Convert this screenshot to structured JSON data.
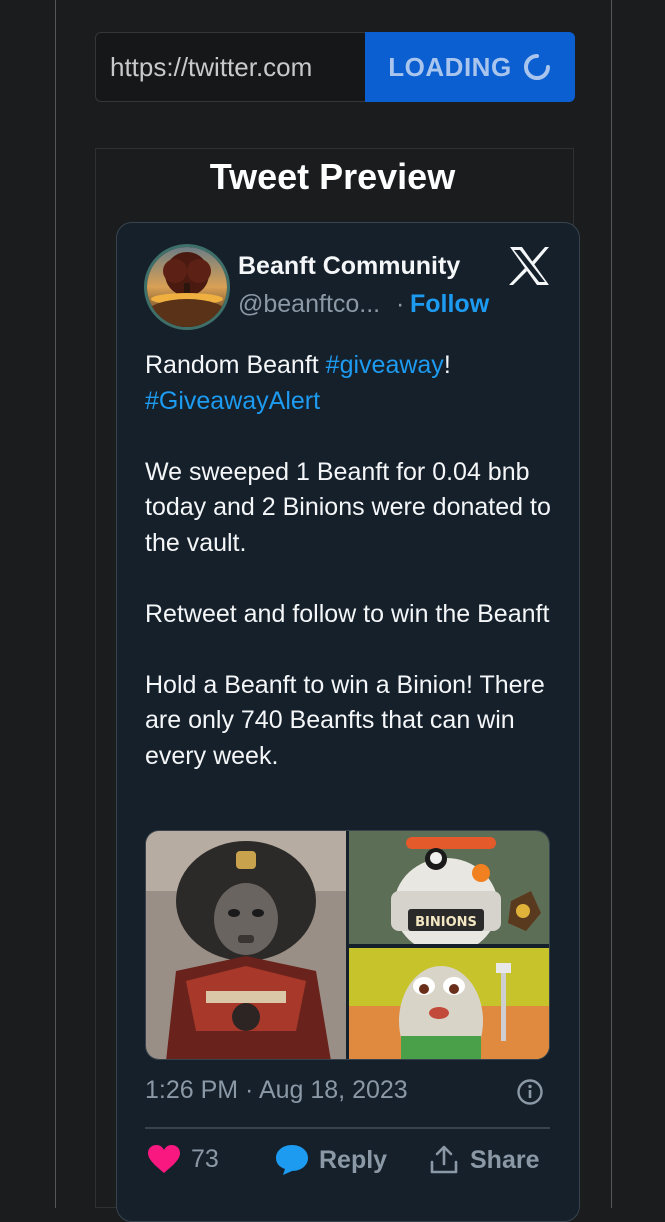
{
  "url_bar": {
    "url_value": "https://twitter.com",
    "load_button_label": "LOADING"
  },
  "preview": {
    "title": "Tweet Preview"
  },
  "tweet": {
    "author_name": "Beanft Community",
    "handle": "@beanftco...",
    "separator": "·",
    "follow_label": "Follow",
    "text": {
      "l1_prefix": "Random Beanft ",
      "l1_tag": "#giveaway",
      "l1_suffix": "!",
      "l2_tag": "#GiveawayAlert",
      "p2": "We sweeped 1 Beanft for 0.04 bnb today and 2 Binions were donated to the vault.",
      "p3": "Retweet and follow to win the Beanft",
      "p4": "Hold a Beanft to win a Binion! There are only 740 Beanfts that can win every week."
    },
    "media": {
      "binions_label": "BINIONS"
    },
    "timestamp": "1:26 PM · Aug 18, 2023",
    "like_count": "73",
    "reply_label": "Reply",
    "share_label": "Share"
  },
  "colors": {
    "accent_blue": "#1d9bf0",
    "button_blue": "#0b5fd1",
    "like_pink": "#f91880",
    "card_bg": "#15202b"
  }
}
